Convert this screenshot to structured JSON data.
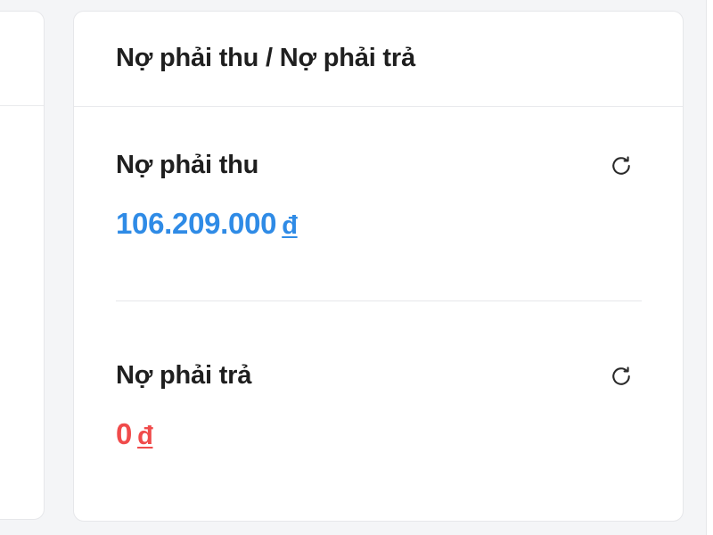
{
  "card": {
    "title": "Nợ phải thu / Nợ phải trả"
  },
  "receivable": {
    "label": "Nợ phải thu",
    "amount": "106.209.000",
    "currency": "đ",
    "color": "#2f8be6",
    "refresh_icon": "refresh-icon"
  },
  "payable": {
    "label": "Nợ phải trả",
    "amount": "0",
    "currency": "đ",
    "color": "#f04b4b",
    "refresh_icon": "refresh-icon"
  }
}
